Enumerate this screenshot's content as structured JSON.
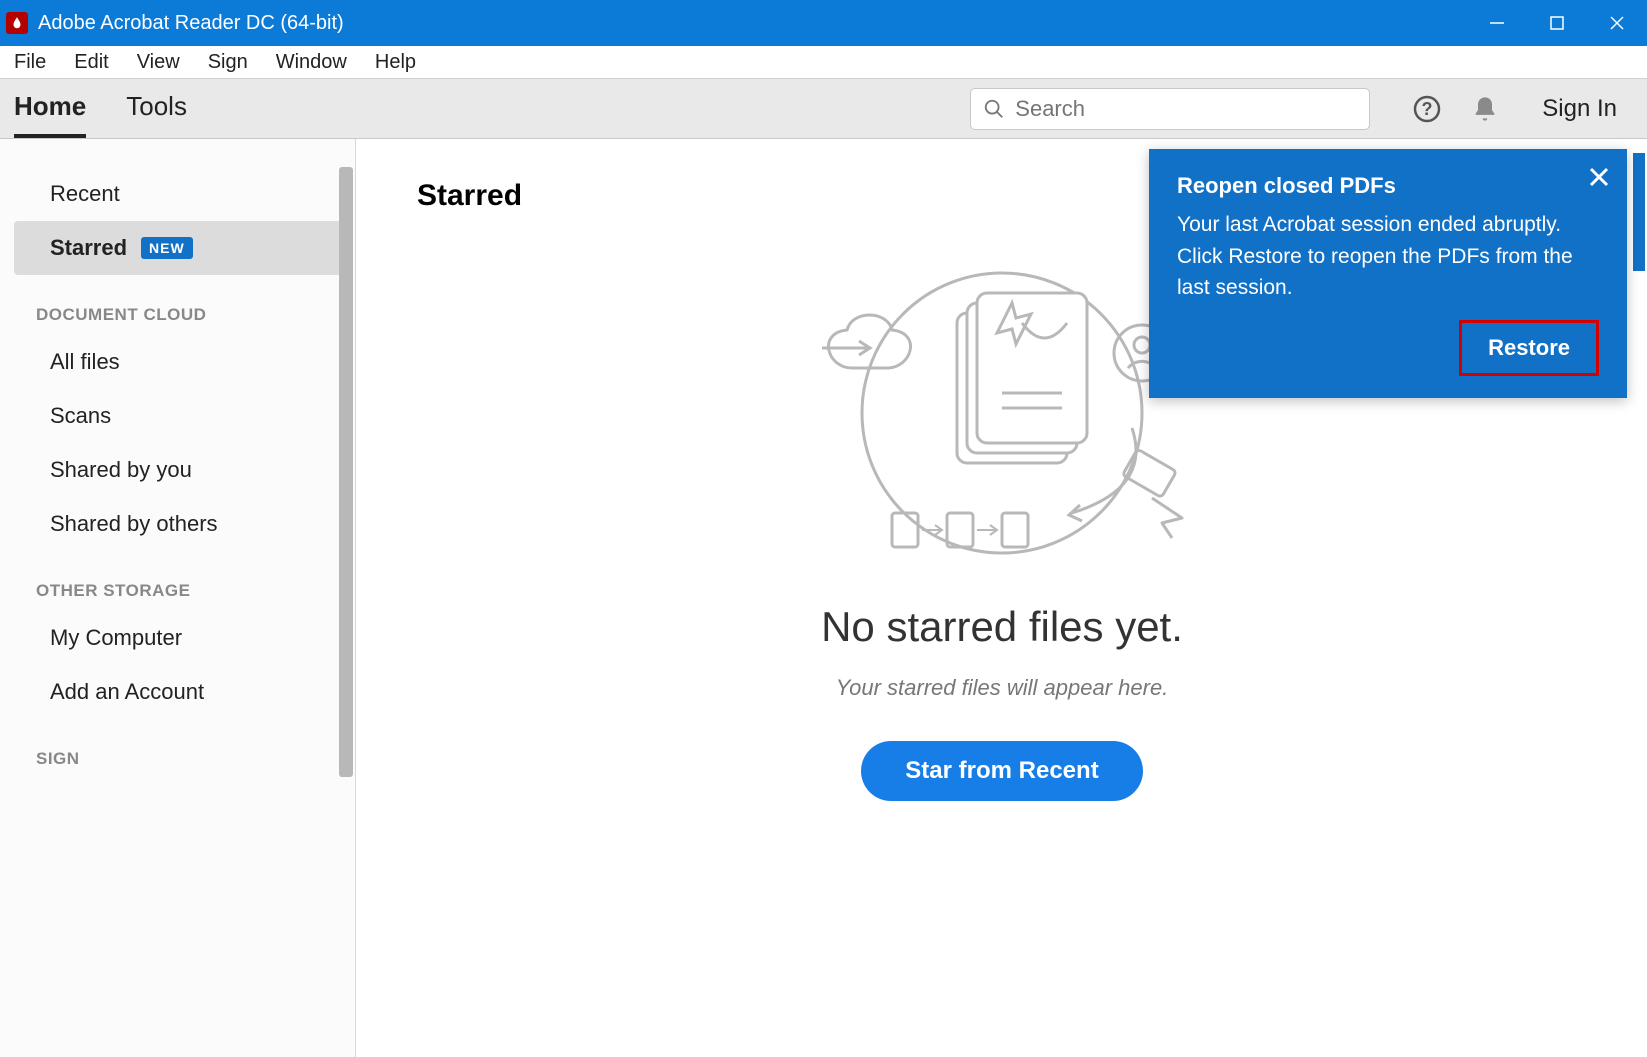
{
  "window": {
    "title": "Adobe Acrobat Reader DC (64-bit)"
  },
  "menu": {
    "items": [
      "File",
      "Edit",
      "View",
      "Sign",
      "Window",
      "Help"
    ]
  },
  "toolbar": {
    "tabs": {
      "home": "Home",
      "tools": "Tools"
    },
    "search_placeholder": "Search",
    "signin": "Sign In"
  },
  "sidebar": {
    "items": {
      "recent": "Recent",
      "starred": "Starred",
      "starred_badge": "NEW",
      "all_files": "All files",
      "scans": "Scans",
      "shared_by_you": "Shared by you",
      "shared_by_others": "Shared by others",
      "my_computer": "My Computer",
      "add_account": "Add an Account"
    },
    "headers": {
      "cloud": "DOCUMENT CLOUD",
      "other": "OTHER STORAGE",
      "sign": "SIGN"
    }
  },
  "main": {
    "title": "Starred",
    "empty_title": "No starred files yet.",
    "empty_sub": "Your starred files will appear here.",
    "cta": "Star from Recent"
  },
  "popup": {
    "title": "Reopen closed PDFs",
    "text": "Your last Acrobat session ended abruptly. Click Restore to reopen the PDFs from the last session.",
    "action": "Restore"
  }
}
